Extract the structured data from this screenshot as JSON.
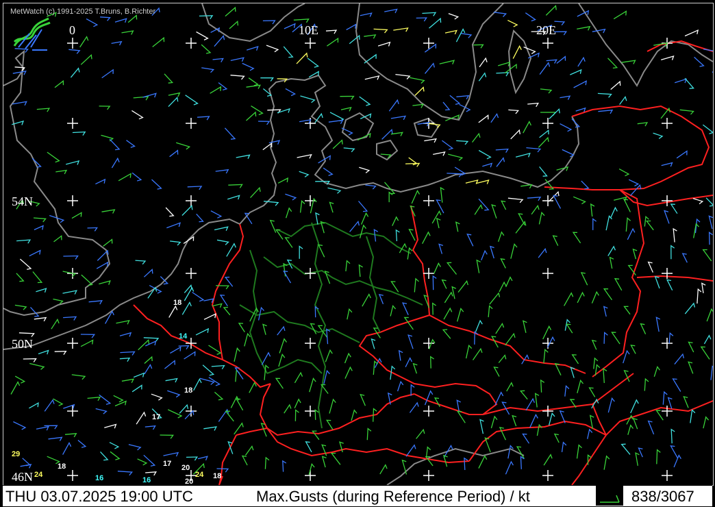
{
  "app": {
    "copyright": "MetWatch  (c) 1991-2025 T.Bruns, B.Richter"
  },
  "map": {
    "longitude_labels": [
      "0",
      "10E",
      "20E"
    ],
    "latitude_labels": [
      "54N",
      "50N",
      "46N"
    ],
    "station_values": [
      {
        "text": "18",
        "color": "#ffffff"
      },
      {
        "text": "14",
        "color": "#40ffff"
      },
      {
        "text": "18",
        "color": "#ffffff"
      },
      {
        "text": "17",
        "color": "#ffffff"
      },
      {
        "text": "29",
        "color": "#ffff60"
      },
      {
        "text": "24",
        "color": "#ffff60"
      },
      {
        "text": "18",
        "color": "#ffffff"
      },
      {
        "text": "17",
        "color": "#ffffff"
      },
      {
        "text": "20",
        "color": "#ffffff"
      },
      {
        "text": "24",
        "color": "#ffff60"
      },
      {
        "text": "16",
        "color": "#40ffff"
      },
      {
        "text": "16",
        "color": "#40ffff"
      },
      {
        "text": "20",
        "color": "#ffffff"
      },
      {
        "text": "18",
        "color": "#ffffff"
      }
    ],
    "colors": {
      "background": "#000000",
      "coastline": "#8a8a8a",
      "borders": "#ff2020",
      "region_borders": "#1f7a1f",
      "grid_cross": "#ffffff",
      "barb_green": "#39d339",
      "barb_blue": "#3a78ff",
      "barb_cyan": "#40e0e0",
      "barb_white": "#ffffff",
      "barb_yellow": "#ffff60"
    },
    "icons": {
      "logo": "metwatch-logo-icon",
      "grid": "plus-cross-icon",
      "barb": "wind-barb-icon"
    }
  },
  "status": {
    "datetime": "THU 03.07.2025 19:00 UTC",
    "parameter": "Max.Gusts (during Reference Period) / kt",
    "counter": "838/3067"
  }
}
